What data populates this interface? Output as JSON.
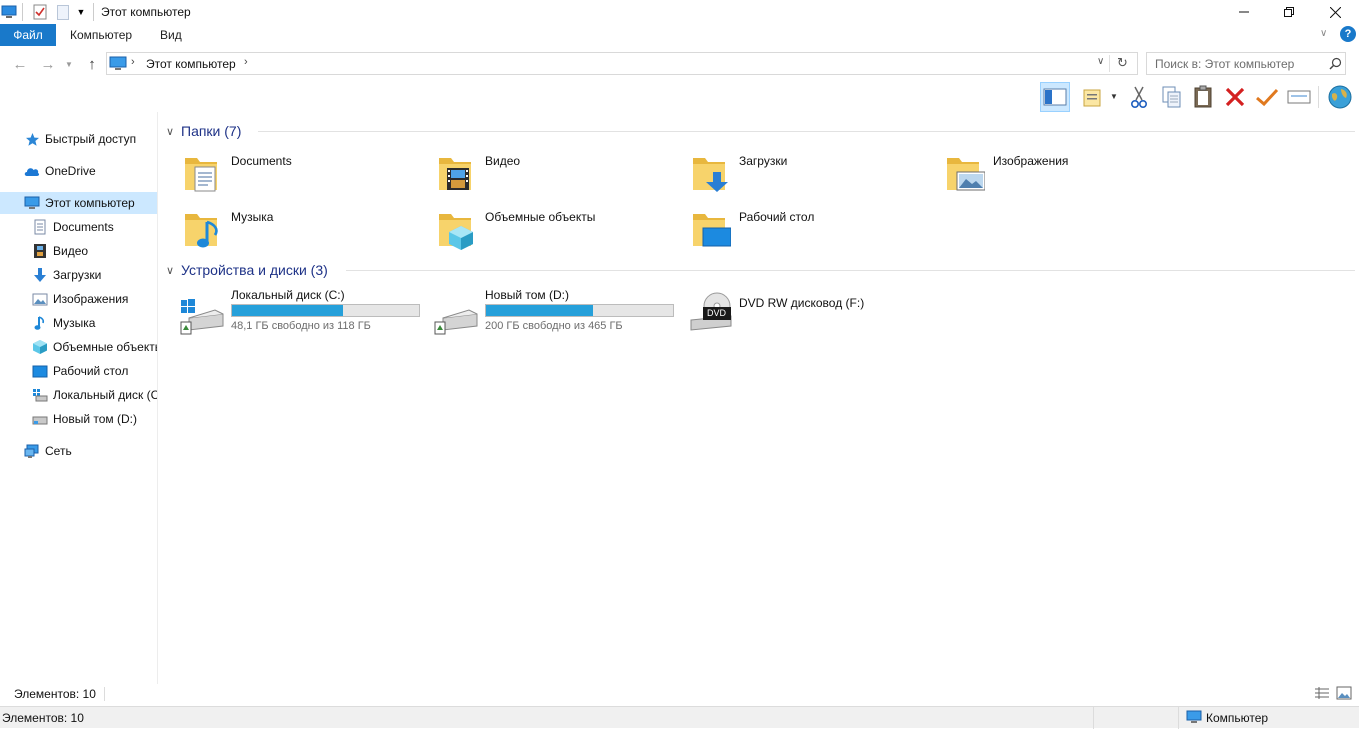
{
  "window": {
    "title": "Этот компьютер"
  },
  "ribbon": {
    "tabs": [
      {
        "label": "Файл",
        "active": true
      },
      {
        "label": "Компьютер",
        "active": false
      },
      {
        "label": "Вид",
        "active": false
      }
    ]
  },
  "address": {
    "path": "Этот компьютер",
    "search_placeholder": "Поиск в: Этот компьютер"
  },
  "nav": {
    "quick_access": "Быстрый доступ",
    "onedrive": "OneDrive",
    "this_pc": "Этот компьютер",
    "children": [
      {
        "label": "Documents",
        "icon": "documents-icon"
      },
      {
        "label": "Видео",
        "icon": "video-icon"
      },
      {
        "label": "Загрузки",
        "icon": "downloads-icon"
      },
      {
        "label": "Изображения",
        "icon": "pictures-icon"
      },
      {
        "label": "Музыка",
        "icon": "music-icon"
      },
      {
        "label": "Объемные объекты",
        "icon": "3d-objects-icon"
      },
      {
        "label": "Рабочий стол",
        "icon": "desktop-icon"
      },
      {
        "label": "Локальный диск (C:)",
        "icon": "local-disk-icon"
      },
      {
        "label": "Новый том (D:)",
        "icon": "drive-icon"
      }
    ],
    "network": "Сеть"
  },
  "folders": {
    "header": "Папки (7)",
    "items": [
      {
        "name": "Documents",
        "icon": "documents-folder-icon"
      },
      {
        "name": "Видео",
        "icon": "video-folder-icon"
      },
      {
        "name": "Загрузки",
        "icon": "downloads-folder-icon"
      },
      {
        "name": "Изображения",
        "icon": "pictures-folder-icon"
      },
      {
        "name": "Музыка",
        "icon": "music-folder-icon"
      },
      {
        "name": "Объемные объекты",
        "icon": "3d-objects-folder-icon"
      },
      {
        "name": "Рабочий стол",
        "icon": "desktop-folder-icon"
      }
    ]
  },
  "drives": {
    "header": "Устройства и диски (3)",
    "items": [
      {
        "name": "Локальный диск (C:)",
        "free": "48,1 ГБ свободно из 118 ГБ",
        "used_fraction": 0.592
      },
      {
        "name": "Новый том (D:)",
        "free": "200 ГБ свободно из 465 ГБ",
        "used_fraction": 0.57
      },
      {
        "name": "DVD RW дисковод (F:)",
        "dvd_label": "DVD"
      }
    ]
  },
  "status": {
    "items_count": "Элементов: 10",
    "bottom_items": "Элементов: 10",
    "zone": "Компьютер"
  },
  "colors": {
    "accent": "#1979ca",
    "selection": "#cce8ff",
    "progress": "#26a0da",
    "group_header": "#1e3287"
  }
}
